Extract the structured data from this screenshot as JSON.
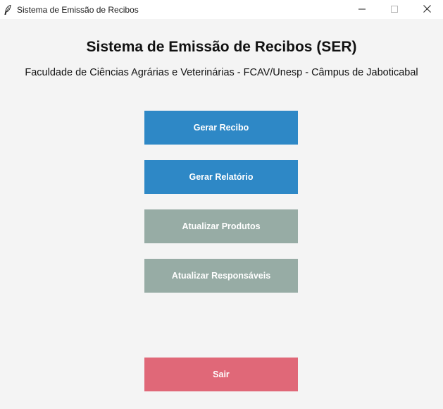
{
  "window": {
    "title": "Sistema de Emissão de Recibos",
    "icon": "feather-icon",
    "controls": [
      "minimize-icon",
      "maximize-icon",
      "close-icon"
    ]
  },
  "main": {
    "heading": "Sistema de Emissão de Recibos (SER)",
    "subheading": "Faculdade de Ciências Agrárias e Veterinárias - FCAV/Unesp - Câmpus de Jaboticabal"
  },
  "buttons": {
    "gerar_recibo": "Gerar Recibo",
    "gerar_relatorio": "Gerar Relatório",
    "atualizar_produtos": "Atualizar Produtos",
    "atualizar_responsaveis": "Atualizar Responsáveis",
    "sair": "Sair"
  },
  "colors": {
    "primary": "#2e88c6",
    "secondary": "#97aca5",
    "danger": "#e06878",
    "background": "#f4f4f4"
  }
}
